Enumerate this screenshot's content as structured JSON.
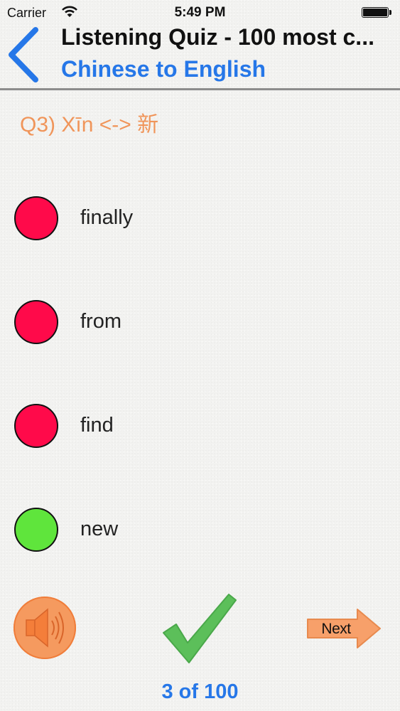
{
  "status_bar": {
    "carrier": "Carrier",
    "time": "5:49 PM"
  },
  "nav": {
    "title": "Listening Quiz - 100 most c...",
    "subtitle": "Chinese to English"
  },
  "question": {
    "text": "Q3) Xīn <-> 新"
  },
  "options": [
    {
      "label": "finally",
      "status": "incorrect",
      "color": "#ff0a4a"
    },
    {
      "label": "from",
      "status": "incorrect",
      "color": "#ff0a4a"
    },
    {
      "label": "find",
      "status": "incorrect",
      "color": "#ff0a4a"
    },
    {
      "label": "new",
      "status": "correct",
      "color": "#5fe53c"
    }
  ],
  "controls": {
    "speaker_icon": "speaker-icon",
    "check_icon": "checkmark-icon",
    "next_label": "Next"
  },
  "progress": {
    "text": "3 of 100"
  },
  "colors": {
    "accent": "#2677e8",
    "question": "#f0955a",
    "check": "#5cbf5a",
    "next_arrow": "#f7a06a"
  }
}
